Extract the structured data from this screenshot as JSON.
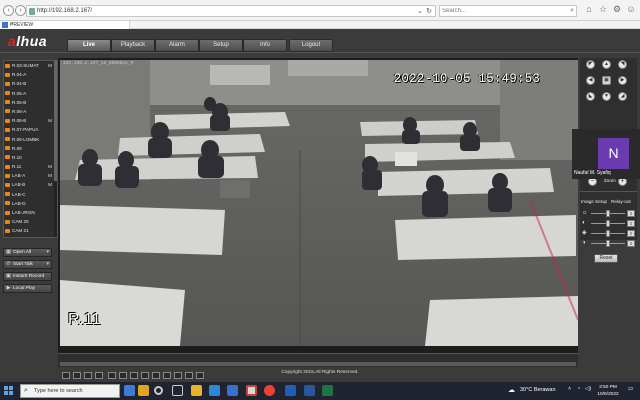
{
  "browser": {
    "url": "http://192.168.2.167/",
    "search_placeholder": "Search...",
    "tab_title": "PREVIEW"
  },
  "app": {
    "logo": "alhua",
    "tabs": [
      "Live",
      "Playback",
      "Alarm",
      "Setup",
      "Info",
      "Logout"
    ],
    "active_tab": "Live",
    "footer": "Copyright 2015,All Rights Reserved."
  },
  "channels": [
    {
      "name": "R.03-SUMAT",
      "flag": "M"
    },
    {
      "name": "R.04-A",
      "flag": ""
    },
    {
      "name": "R.04-B",
      "flag": ""
    },
    {
      "name": "R.05-A",
      "flag": ""
    },
    {
      "name": "R.05-B",
      "flag": ""
    },
    {
      "name": "R.06-A",
      "flag": ""
    },
    {
      "name": "R.06-B",
      "flag": "M"
    },
    {
      "name": "R.07-PAPUA",
      "flag": ""
    },
    {
      "name": "R.08-LOMBK",
      "flag": ""
    },
    {
      "name": "R.09",
      "flag": ""
    },
    {
      "name": "R.10",
      "flag": ""
    },
    {
      "name": "R.11",
      "flag": "M"
    },
    {
      "name": "LAB-A",
      "flag": "M"
    },
    {
      "name": "LAB-B",
      "flag": "M"
    },
    {
      "name": "LAB-C",
      "flag": ""
    },
    {
      "name": "LAB-D",
      "flag": ""
    },
    {
      "name": "LAB-JRGN",
      "flag": ""
    },
    {
      "name": "CAM 20",
      "flag": ""
    },
    {
      "name": "CAM 21",
      "flag": ""
    }
  ],
  "left_buttons": {
    "open_all": "Open All",
    "start_talk": "Start Talk",
    "instant_record": "Instant Record",
    "local_play": "Local Play"
  },
  "video": {
    "stream_info": "192.168.2.167_16_800Kbps_M",
    "timestamp": "2022-10-05 15:49:53",
    "camera_label": "R.11"
  },
  "ptz": {
    "zoom_label": "Zoom",
    "image_setup": "Image Setup",
    "relay_out": "Relay-out",
    "reset": "Reset",
    "sliders": [
      {
        "icon": "brightness-icon",
        "level": 0.5
      },
      {
        "icon": "contrast-icon",
        "level": 0.5
      },
      {
        "icon": "saturation-icon",
        "level": 0.5
      },
      {
        "icon": "hue-icon",
        "level": 0.5
      }
    ]
  },
  "participant": {
    "initial": "N",
    "name": "Naufal M. Syafiq"
  },
  "taskbar": {
    "search_placeholder": "Type here to search",
    "weather": "30°C  Berawan",
    "time": "3:50 PM",
    "date": "10/5/2022"
  },
  "colors": {
    "accent": "#e88a12",
    "brand_red": "#d22222",
    "avatar": "#6a3bb0"
  }
}
